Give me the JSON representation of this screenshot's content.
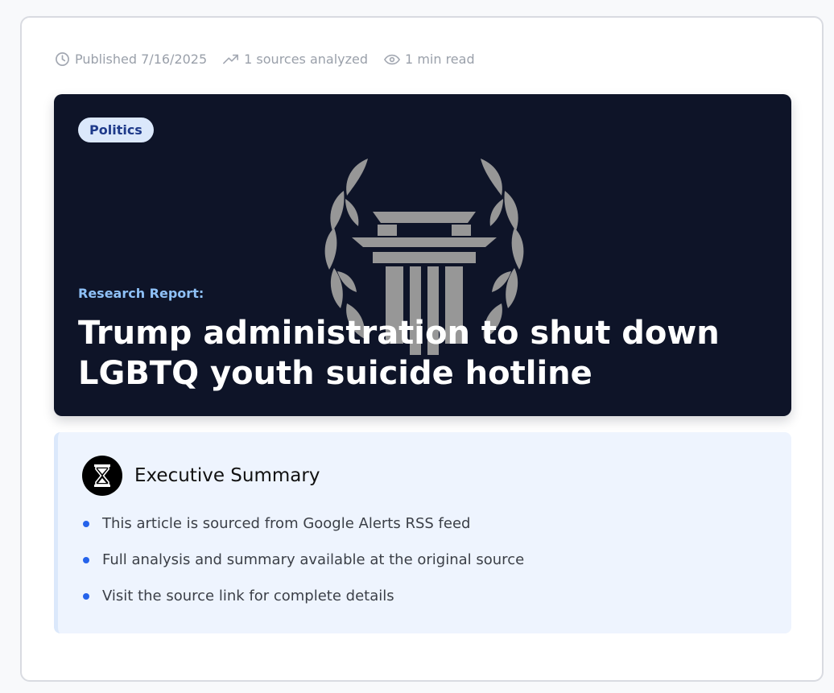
{
  "meta": {
    "published": "Published 7/16/2025",
    "sources": "1 sources analyzed",
    "read_time": "1 min read",
    "icons": [
      "clock-icon",
      "trending-up-icon",
      "eye-icon"
    ]
  },
  "hero": {
    "badge": "Politics",
    "kicker": "Research Report:",
    "title": "Trump administration to shut down LGBTQ youth suicide hotline",
    "background_color": "#0e1428",
    "logo": "pillar-laurel-logo"
  },
  "summary": {
    "title": "Executive Summary",
    "logo": "hourglass-logo",
    "bullets": [
      "This article is sourced from Google Alerts RSS feed",
      "Full analysis and summary available at the original source",
      "Visit the source link for complete details"
    ],
    "accent_color": "#2563eb"
  }
}
